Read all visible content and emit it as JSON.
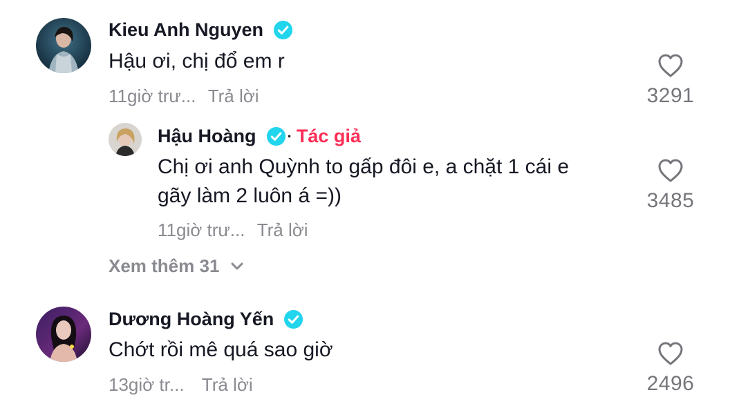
{
  "comments": [
    {
      "author": "Kieu Anh Nguyen",
      "text": "Hậu ơi, chị đổ em r",
      "time": "11giờ trư...",
      "reply_label": "Trả lời",
      "likes": "3291",
      "verified": true
    },
    {
      "author": "Hậu Hoàng",
      "author_tag": "Tác giả",
      "text_line1": "Chị ơi anh Quỳnh to gấp đôi e, a chặt 1 cái e",
      "text_line2": "gãy làm 2 luôn á =))",
      "time": "11giờ trư...",
      "reply_label": "Trả lời",
      "likes": "3485",
      "verified": true
    },
    {
      "author": "Dương Hoàng Yến",
      "text": "Chớt rồi mê quá sao giờ",
      "time": "13giờ tr...",
      "reply_label": "Trả lời",
      "likes": "2496",
      "verified": true
    }
  ],
  "view_more_label": "Xem thêm 31",
  "colors": {
    "verified": "#20d5ec",
    "author_tag": "#fe2c55",
    "meta": "#8a8b91"
  }
}
